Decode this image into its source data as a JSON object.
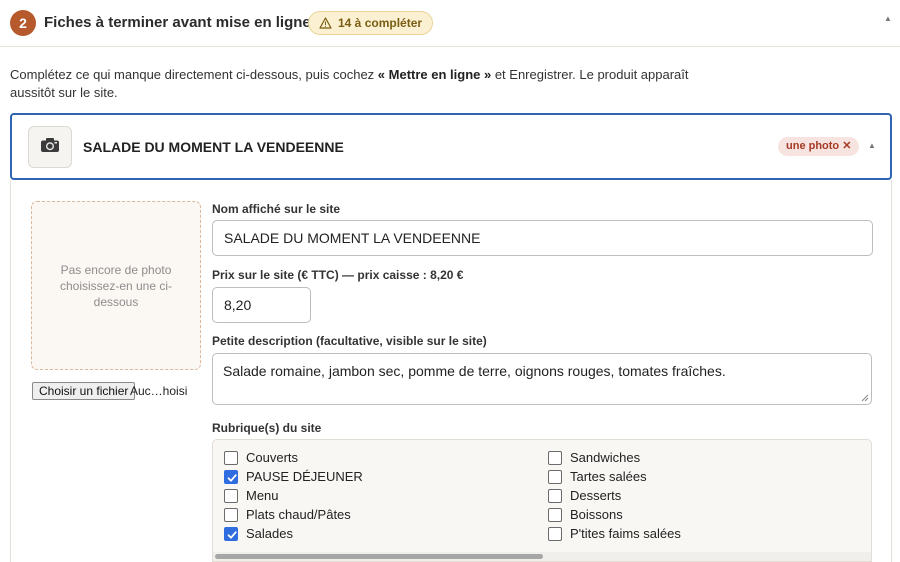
{
  "section": {
    "step": "2",
    "title": "Fiches à terminer avant mise en ligne",
    "pending_badge": "14 à compléter",
    "collapse_icon": "▲"
  },
  "intro": {
    "part1": "Complétez ce qui manque directement ci-dessous, puis cochez ",
    "bold": "« Mettre en ligne »",
    "part2": " et Enregistrer. Le produit apparaît aussitôt sur le site."
  },
  "product": {
    "name": "SALADE DU MOMENT LA VENDEENNE",
    "missing_tag": "une photo ✕",
    "thumb_icon": "camera-icon",
    "collapse_icon": "▲",
    "photo_placeholder": "Pas encore de photo choisissez-en une ci-dessous",
    "file_button": "Choisir un fichier",
    "file_status": "Auc…hoisi",
    "name_label": "Nom affiché sur le site",
    "name_value": "SALADE DU MOMENT LA VENDEENNE",
    "price_label": "Prix sur le site (€ TTC) — prix caisse : 8,20 €",
    "price_value": "8,20",
    "desc_label": "Petite description (facultative, visible sur le site)",
    "desc_value": "Salade romaine, jambon sec, pomme de terre, oignons rouges, tomates fraîches.",
    "rubriques_label": "Rubrique(s) du site",
    "rubriques_col1": [
      {
        "label": "Couverts",
        "checked": false
      },
      {
        "label": "PAUSE DÉJEUNER",
        "checked": true
      },
      {
        "label": "Menu",
        "checked": false
      },
      {
        "label": "Plats chaud/Pâtes",
        "checked": false
      },
      {
        "label": "Salades",
        "checked": true
      }
    ],
    "rubriques_col2": [
      {
        "label": "Sandwiches",
        "checked": false
      },
      {
        "label": "Tartes salées",
        "checked": false
      },
      {
        "label": "Desserts",
        "checked": false
      },
      {
        "label": "Boissons",
        "checked": false
      },
      {
        "label": "P'tites faims salées",
        "checked": false
      }
    ]
  },
  "colors": {
    "accent": "#2e64b1",
    "step_badge": "#b65a2e",
    "checkbox": "#2f6ce0",
    "missing_tag_bg": "#f7e3df",
    "missing_tag_text": "#a63a26",
    "pending_bg": "#fbf1d2"
  }
}
